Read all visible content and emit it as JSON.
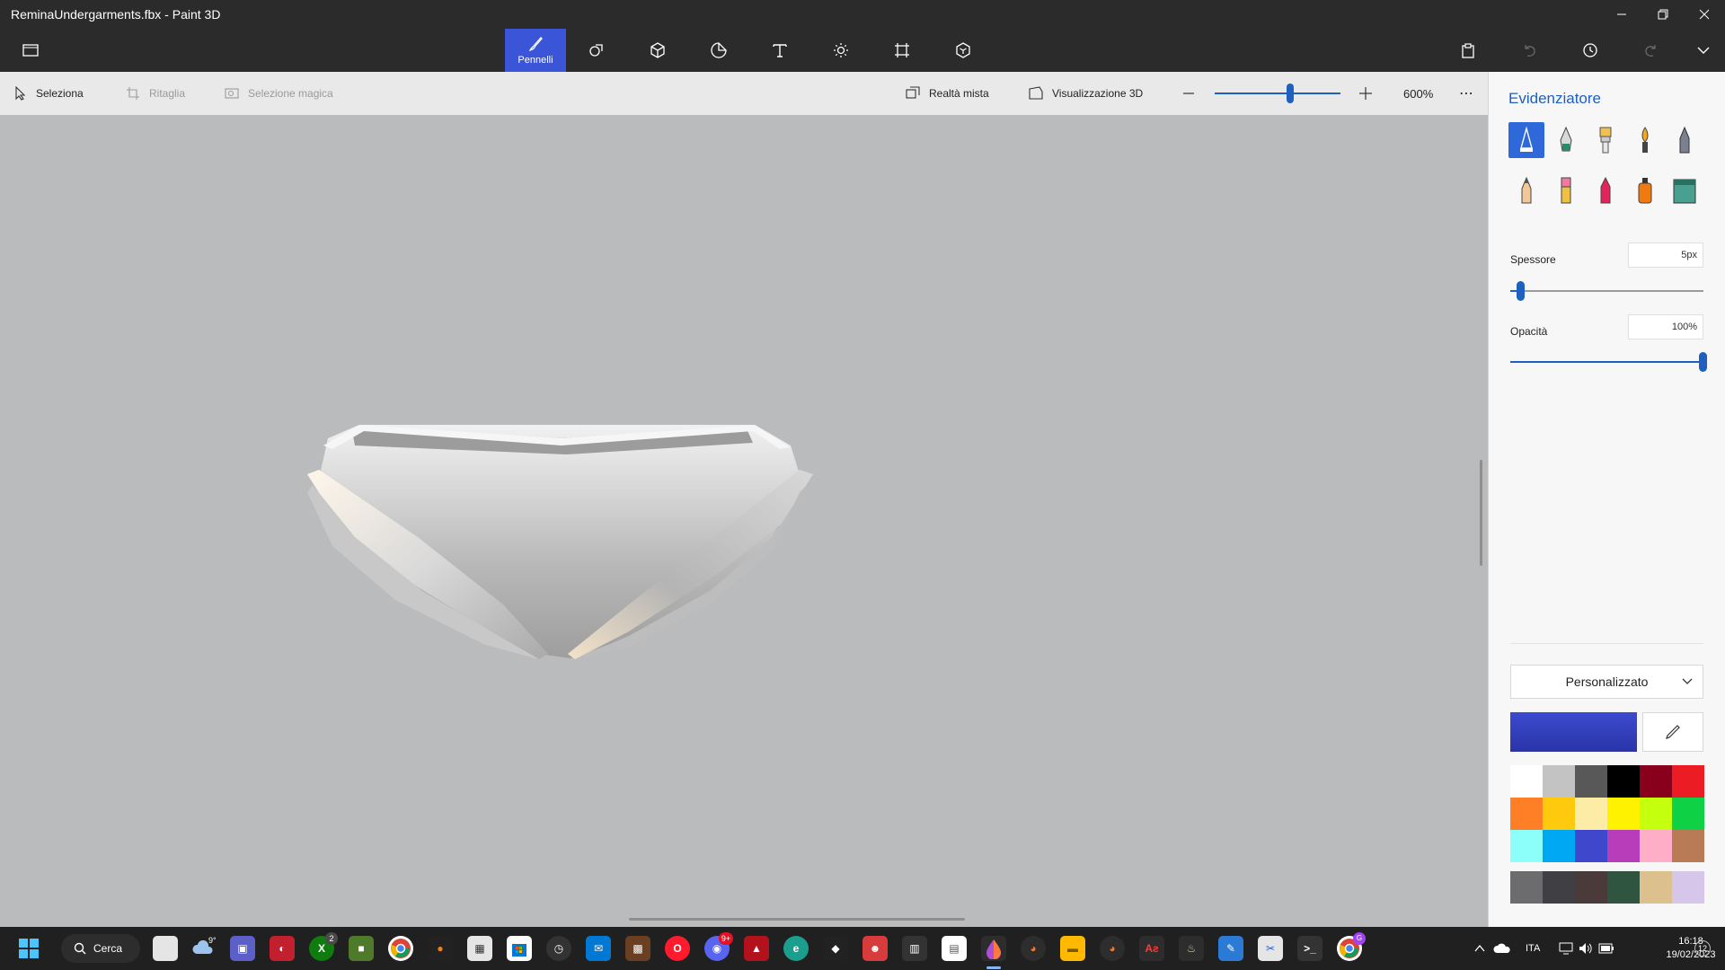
{
  "window": {
    "title": "ReminaUndergarments.fbx - Paint 3D"
  },
  "toolbar": {
    "tabs": [
      {
        "label": "Pennelli",
        "icon": "brush-icon",
        "active": true
      },
      {
        "icon": "2d-shapes-icon"
      },
      {
        "icon": "3d-shapes-icon"
      },
      {
        "icon": "stickers-icon"
      },
      {
        "icon": "text-icon"
      },
      {
        "icon": "effects-icon"
      },
      {
        "icon": "canvas-icon"
      },
      {
        "icon": "3d-library-icon"
      }
    ],
    "right_icons": [
      "paste-icon",
      "undo-icon",
      "history-icon",
      "redo-icon",
      "expand-icon"
    ]
  },
  "subbar": {
    "select": "Seleziona",
    "crop": "Ritaglia",
    "magic_select": "Selezione magica",
    "mixed_reality": "Realtà mista",
    "view3d": "Visualizzazione 3D",
    "zoom_label": "600%",
    "zoom_level": 0.6
  },
  "panel": {
    "title": "Evidenziatore",
    "thickness_label": "Spessore",
    "thickness_value": "5px",
    "thickness_level": 0.05,
    "opacity_label": "Opacità",
    "opacity_value": "100%",
    "opacity_level": 1.0,
    "palette_mode": "Personalizzato",
    "current_color": "#3b4bd0",
    "brushes": [
      "marker-icon",
      "calligraphy-pen-icon",
      "oil-brush-icon",
      "watercolor-icon",
      "pixel-pen-icon",
      "pencil-icon",
      "eraser-icon",
      "crayon-icon",
      "spray-can-icon",
      "fill-bucket-icon"
    ],
    "colors": [
      "#ffffff",
      "#c3c3c3",
      "#585858",
      "#000000",
      "#88001b",
      "#ec1c24",
      "#ff7f27",
      "#ffc90e",
      "#fdeca6",
      "#fff200",
      "#c4ff0e",
      "#0ed145",
      "#8cfffb",
      "#00a8f3",
      "#3f48cc",
      "#b83dba",
      "#ffaec8",
      "#b97a56"
    ],
    "custom_colors": [
      "#6c6c6e",
      "#3f3f44",
      "#4a3a3a",
      "#2f5440",
      "#dcc08e",
      "#d6c6ea"
    ]
  },
  "taskbar": {
    "search_label": "Cerca",
    "weather": "9°",
    "language": "ITA",
    "time": "16:18",
    "date": "19/02/2023",
    "notif_count": "12",
    "xbox_badge": "2",
    "discord_badge": "9+",
    "chrome_badge": "G"
  }
}
